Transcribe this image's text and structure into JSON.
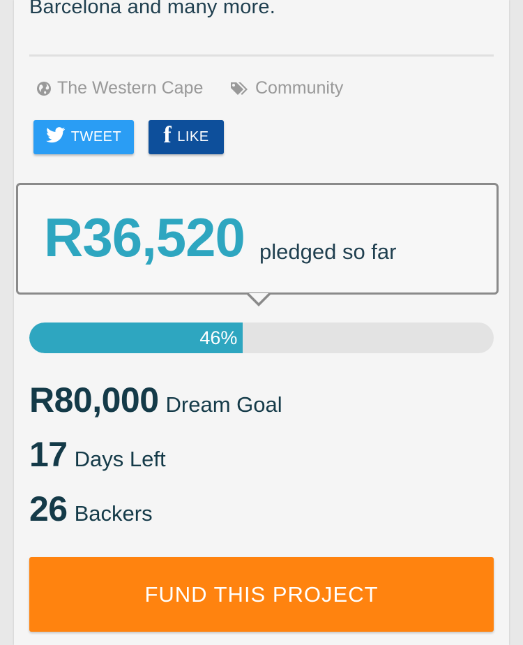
{
  "project": {
    "description_tail": "Barcelona and many more.",
    "location": "The Western Cape",
    "category": "Community"
  },
  "share": {
    "tweet_label": "TWEET",
    "like_label": "LIKE",
    "tweet_color": "#2a9df4",
    "like_color": "#0d4f9b"
  },
  "funding": {
    "pledged_amount": "R36,520",
    "pledged_label": "pledged so far",
    "progress_percent": 46,
    "progress_label": "46%",
    "goal_amount": "R80,000",
    "goal_label": "Dream Goal",
    "days_left": "17",
    "days_label": "Days Left",
    "backers": "26",
    "backers_label": "Backers"
  },
  "cta": {
    "fund_label": "FUND THIS PROJECT",
    "color": "#ff830f"
  },
  "icons": {
    "location": "globe-icon",
    "category": "tags-icon",
    "tweet": "twitter-bird-icon",
    "like": "facebook-f-icon"
  },
  "colors": {
    "accent": "#2ea6c0",
    "text_dark": "#143a48",
    "muted": "#999999"
  }
}
